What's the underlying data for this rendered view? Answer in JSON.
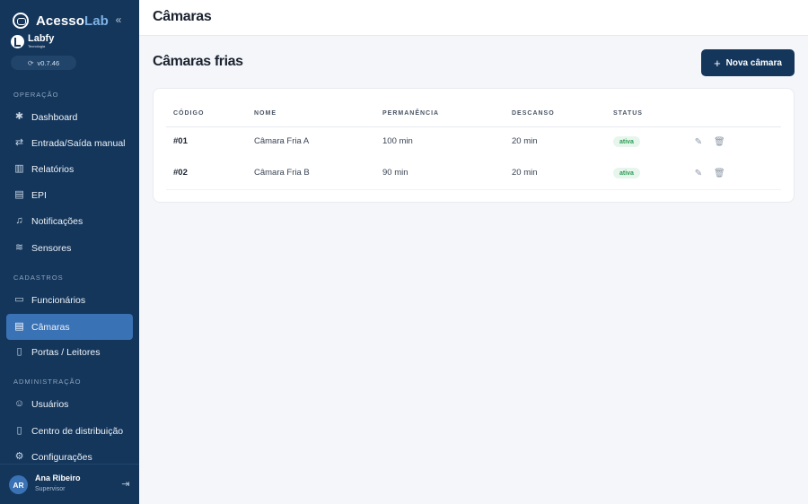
{
  "brand": {
    "name_main": "Acesso",
    "name_accent": "Lab",
    "partner_name": "Labfy",
    "partner_sub": "Tecnologia",
    "version": "v0.7.46"
  },
  "colors": {
    "sidebar_bg": "#14365b",
    "active_item": "#3a72b6",
    "primary_button": "#14365b",
    "status_badge_bg": "#e6f6ec",
    "status_badge_text": "#2e9b54"
  },
  "sidebar": {
    "sections": [
      {
        "title": "OPERAÇÃO",
        "items": [
          {
            "label": "Dashboard",
            "icon": "dashboard-icon"
          },
          {
            "label": "Entrada/Saída manual",
            "icon": "swap-icon"
          },
          {
            "label": "Relatórios",
            "icon": "bar-chart-icon"
          },
          {
            "label": "EPI",
            "icon": "building-icon"
          },
          {
            "label": "Notificações",
            "icon": "bell-icon"
          },
          {
            "label": "Sensores",
            "icon": "wifi-icon"
          }
        ]
      },
      {
        "title": "CADASTROS",
        "items": [
          {
            "label": "Funcionários",
            "icon": "id-card-icon"
          },
          {
            "label": "Câmaras",
            "icon": "building-icon",
            "active": true
          },
          {
            "label": "Portas / Leitores",
            "icon": "door-icon"
          }
        ]
      },
      {
        "title": "ADMINISTRAÇÃO",
        "items": [
          {
            "label": "Usuários",
            "icon": "users-icon"
          },
          {
            "label": "Centro de distribuição",
            "icon": "building-icon"
          },
          {
            "label": "Configurações",
            "icon": "gear-icon"
          }
        ]
      }
    ],
    "user": {
      "initials": "AR",
      "name": "Ana Ribeiro",
      "role": "Supervisor"
    }
  },
  "topbar": {
    "title": "Câmaras"
  },
  "page": {
    "title": "Câmaras frias",
    "new_button": "Nova câmara"
  },
  "table": {
    "headers": [
      "CÓDIGO",
      "NOME",
      "PERMANÊNCIA",
      "DESCANSO",
      "STATUS"
    ],
    "rows": [
      {
        "code": "#01",
        "name": "Câmara Fria A",
        "permanence": "100 min",
        "rest": "20 min",
        "status": "ativa"
      },
      {
        "code": "#02",
        "name": "Câmara Fria B",
        "permanence": "90 min",
        "rest": "20 min",
        "status": "ativa"
      }
    ]
  }
}
